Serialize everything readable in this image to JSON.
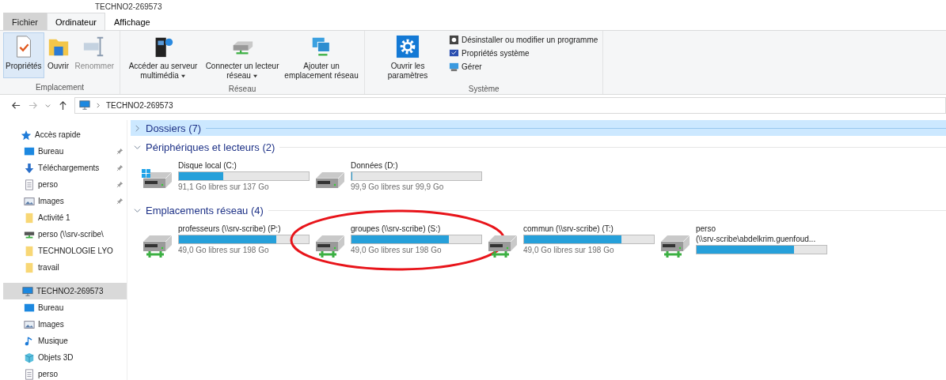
{
  "window": {
    "title": "TECHNO2-269573"
  },
  "ribbon_tabs": [
    {
      "label": "Fichier",
      "kind": "file",
      "selected": false
    },
    {
      "label": "Ordinateur",
      "kind": "tab",
      "selected": true
    },
    {
      "label": "Affichage",
      "kind": "tab",
      "selected": false
    }
  ],
  "ribbon_groups": [
    {
      "label": "Emplacement",
      "commands": [
        {
          "label": "Propriétés",
          "kind": "properties",
          "selected": true,
          "disabled": false
        },
        {
          "label": "Ouvrir",
          "kind": "open",
          "selected": false,
          "disabled": false
        },
        {
          "label": "Renommer",
          "kind": "rename",
          "selected": false,
          "disabled": true
        }
      ]
    },
    {
      "label": "Réseau",
      "commands": [
        {
          "label": "Accéder au serveur multimédia",
          "kind": "media",
          "dropdown": true,
          "selected": false,
          "disabled": false
        },
        {
          "label": "Connecter un lecteur réseau",
          "kind": "netdrive",
          "dropdown": true,
          "selected": false,
          "disabled": false
        },
        {
          "label": "Ajouter un emplacement réseau",
          "kind": "netplace",
          "selected": false,
          "disabled": false
        }
      ]
    },
    {
      "label": "Système",
      "commands": [
        {
          "label": "Ouvrir les paramètres",
          "kind": "settings",
          "selected": false,
          "disabled": false
        }
      ],
      "small_commands": [
        {
          "label": "Désinstaller ou modifier un programme",
          "kind": "uninstall"
        },
        {
          "label": "Propriétés système",
          "kind": "sysprops"
        },
        {
          "label": "Gérer",
          "kind": "manage"
        }
      ]
    }
  ],
  "address_bar": {
    "path": "TECHNO2-269573"
  },
  "sidebar": {
    "items": [
      {
        "label": "Accès rapide",
        "kind": "star",
        "selected": false,
        "children": [
          {
            "label": "Bureau",
            "kind": "desktop",
            "pinned": true,
            "selected": false
          },
          {
            "label": "Téléchargements",
            "kind": "download",
            "pinned": true,
            "selected": false
          },
          {
            "label": "perso",
            "kind": "document",
            "pinned": true,
            "selected": false
          },
          {
            "label": "Images",
            "kind": "images",
            "pinned": true,
            "selected": false
          },
          {
            "label": "Activité 1",
            "kind": "folder",
            "pinned": false,
            "selected": false
          },
          {
            "label": "perso (\\\\srv-scribe\\",
            "kind": "netdrive",
            "pinned": false,
            "selected": false
          },
          {
            "label": "TECHNOLOGIE LYO",
            "kind": "folder",
            "pinned": false,
            "selected": false
          },
          {
            "label": "travail",
            "kind": "folder",
            "pinned": false,
            "selected": false
          }
        ]
      },
      {
        "label": "TECHNO2-269573",
        "kind": "computer",
        "selected": true,
        "children": [
          {
            "label": "Bureau",
            "kind": "desktop",
            "pinned": false,
            "selected": false
          },
          {
            "label": "Images",
            "kind": "images",
            "pinned": false,
            "selected": false
          },
          {
            "label": "Musique",
            "kind": "music",
            "pinned": false,
            "selected": false
          },
          {
            "label": "Objets 3D",
            "kind": "cube",
            "pinned": false,
            "selected": false
          },
          {
            "label": "perso",
            "kind": "document",
            "pinned": false,
            "selected": false
          }
        ]
      }
    ]
  },
  "groups": [
    {
      "label": "Dossiers (7)",
      "expanded": false,
      "selected": true
    },
    {
      "label": "Périphériques et lecteurs (2)",
      "expanded": true,
      "selected": false,
      "drives": [
        {
          "name": "Disque local (C:)",
          "kind": "system",
          "level": 0.34,
          "free": "91,1 Go libres sur 137 Go",
          "circled": false
        },
        {
          "name": "Données (D:)",
          "kind": "local",
          "level": 0,
          "free": "99,9 Go libres sur 99,9 Go",
          "circled": false
        }
      ]
    },
    {
      "label": "Emplacements réseau (4)",
      "expanded": true,
      "selected": false,
      "drives": [
        {
          "name": "professeurs (\\\\srv-scribe) (P:)",
          "kind": "network",
          "level": 0.75,
          "free": "49,0 Go libres sur 198 Go",
          "circled": false
        },
        {
          "name": "groupes (\\\\srv-scribe) (S:)",
          "kind": "network",
          "level": 0.75,
          "free": "49,0 Go libres sur 198 Go",
          "circled": true
        },
        {
          "name": "commun (\\\\srv-scribe) (T:)",
          "kind": "network",
          "level": 0.75,
          "free": "49,0 Go libres sur 198 Go",
          "circled": false
        },
        {
          "name": "perso",
          "name_line2": "(\\\\srv-scribe\\abdelkrim.guenfoud...",
          "kind": "network",
          "level": 0.75,
          "circled": false
        }
      ]
    }
  ]
}
